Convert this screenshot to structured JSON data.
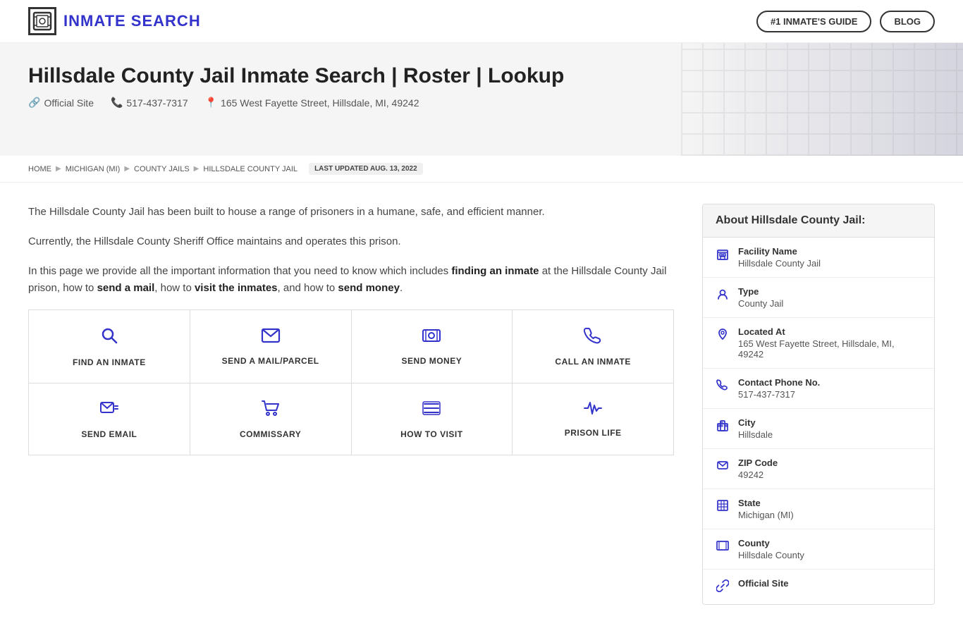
{
  "header": {
    "logo_text": "INMATE SEARCH",
    "logo_icon": "🔒",
    "nav": {
      "guide_label": "#1 INMATE'S GUIDE",
      "blog_label": "BLOG"
    }
  },
  "hero": {
    "title": "Hillsdale County Jail Inmate Search | Roster | Lookup",
    "official_site_label": "Official Site",
    "phone": "517-437-7317",
    "address": "165 West Fayette Street, Hillsdale, MI, 49242"
  },
  "breadcrumb": {
    "items": [
      "HOME",
      "MICHIGAN (MI)",
      "COUNTY JAILS",
      "HILLSDALE COUNTY JAIL"
    ],
    "last_updated": "LAST UPDATED AUG. 13, 2022"
  },
  "content": {
    "paragraph1": "The Hillsdale County Jail has been built to house a range of prisoners in a humane, safe, and efficient manner.",
    "paragraph2": "Currently, the Hillsdale County Sheriff Office maintains and operates this prison.",
    "paragraph3_before": "In this page we provide all the important information that you need to know which includes ",
    "paragraph3_bold1": "finding an inmate",
    "paragraph3_mid1": " at the Hillsdale County Jail prison, how to ",
    "paragraph3_bold2": "send a mail",
    "paragraph3_mid2": ", how to ",
    "paragraph3_bold3": "visit the inmates",
    "paragraph3_mid3": ", and how to ",
    "paragraph3_bold4": "send money",
    "paragraph3_end": "."
  },
  "actions": {
    "row1": [
      {
        "label": "FIND AN INMATE",
        "icon": "search"
      },
      {
        "label": "SEND A MAIL/PARCEL",
        "icon": "mail"
      },
      {
        "label": "SEND MONEY",
        "icon": "money"
      },
      {
        "label": "CALL AN INMATE",
        "icon": "phone"
      }
    ],
    "row2": [
      {
        "label": "SEND EMAIL",
        "icon": "email"
      },
      {
        "label": "COMMISSARY",
        "icon": "cart"
      },
      {
        "label": "HOW TO VISIT",
        "icon": "list"
      },
      {
        "label": "PRISON LIFE",
        "icon": "pulse"
      }
    ]
  },
  "about": {
    "header": "About Hillsdale County Jail:",
    "items": [
      {
        "label": "Facility Name",
        "value": "Hillsdale County Jail",
        "icon": "building"
      },
      {
        "label": "Type",
        "value": "County Jail",
        "icon": "type"
      },
      {
        "label": "Located At",
        "value": "165 West Fayette Street, Hillsdale, MI, 49242",
        "icon": "location"
      },
      {
        "label": "Contact Phone No.",
        "value": "517-437-7317",
        "icon": "phone"
      },
      {
        "label": "City",
        "value": "Hillsdale",
        "icon": "city"
      },
      {
        "label": "ZIP Code",
        "value": "49242",
        "icon": "mail"
      },
      {
        "label": "State",
        "value": "Michigan (MI)",
        "icon": "map"
      },
      {
        "label": "County",
        "value": "Hillsdale County",
        "icon": "county"
      },
      {
        "label": "Official Site",
        "value": "",
        "icon": "link"
      }
    ]
  }
}
